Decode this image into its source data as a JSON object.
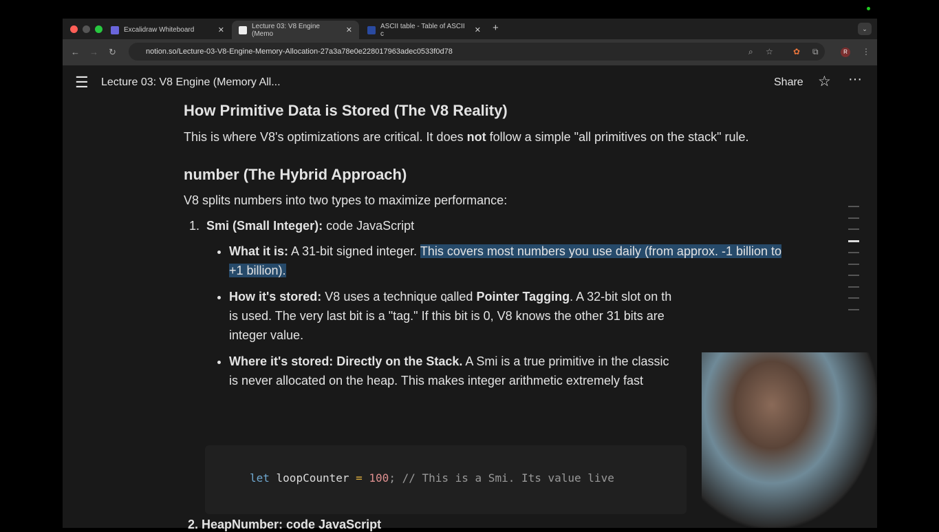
{
  "browser": {
    "tabs": [
      {
        "title": "Excalidraw Whiteboard",
        "icon": "excalidraw-icon"
      },
      {
        "title": "Lecture 03: V8 Engine (Memo",
        "icon": "notion-icon",
        "active": true
      },
      {
        "title": "ASCII table - Table of ASCII c",
        "icon": "ascii-icon"
      }
    ],
    "url": "notion.so/Lecture-03-V8-Engine-Memory-Allocation-27a3a78e0e228017963adec0533f0d78",
    "profile": "R"
  },
  "page": {
    "title": "Lecture 03: V8 Engine (Memory All...",
    "share": "Share"
  },
  "content": {
    "h1": "How Primitive Data is Stored (The V8 Reality)",
    "p1a": "This is where V8's optimizations are critical. It does ",
    "p1b": "not",
    "p1c": " follow a simple \"all primitives on the stack\" rule.",
    "h2": "number (The Hybrid Approach)",
    "p2": "V8 splits numbers into two types to maximize performance:",
    "li1_num": "1.",
    "li1_bold": "Smi (Small Integer):",
    "li1_rest": " code JavaScript",
    "b1_bold": "What it is:",
    "b1_rest": " A 31-bit signed integer. ",
    "b1_hl": "This covers most numbers you use daily (from approx. -1 billion to +1 billion).",
    "b2_bold": "How it's stored:",
    "b2_a": " V8 uses a technique called ",
    "b2_bold2": "Pointer Tagging",
    "b2_b": ". A 32-bit slot on th",
    "b2_c": "is used. The very last bit is a \"tag.\" If this bit is 0, V8 knows the other 31 bits are",
    "b2_d": "integer value.",
    "b3_bold": "Where it's stored: Directly on the Stack.",
    "b3_a": " A Smi is a true primitive in the classic",
    "b3_b": "is never allocated on the heap. This makes integer arithmetic extremely fast",
    "code": {
      "kw": "let",
      "name": " loopCounter ",
      "op": "=",
      "num": " 100",
      "rest": "; // This is a Smi. Its value live"
    },
    "li2": "2. HeapNumber: code JavaScript"
  }
}
